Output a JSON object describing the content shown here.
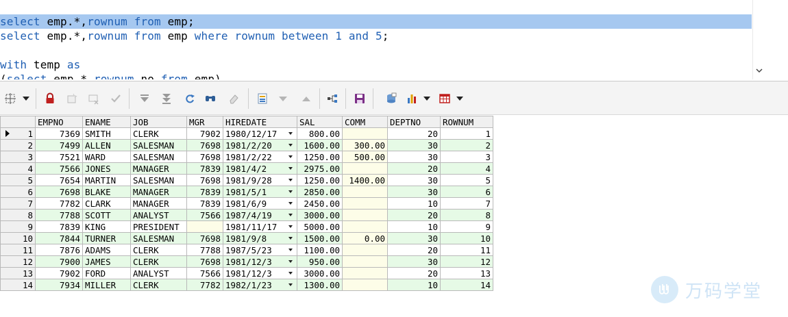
{
  "editor": {
    "lines": [
      {
        "tokens": [
          {
            "t": "select",
            "c": "kw"
          },
          {
            "t": " emp.*,",
            "c": "plain"
          },
          {
            "t": "rownum",
            "c": "kw"
          },
          {
            "t": " ",
            "c": "plain"
          },
          {
            "t": "from",
            "c": "kw"
          },
          {
            "t": " emp;",
            "c": "plain"
          }
        ],
        "highlighted": true
      },
      {
        "tokens": [
          {
            "t": "select",
            "c": "kw"
          },
          {
            "t": " emp.*,",
            "c": "plain"
          },
          {
            "t": "rownum",
            "c": "kw"
          },
          {
            "t": " ",
            "c": "plain"
          },
          {
            "t": "from",
            "c": "kw"
          },
          {
            "t": " emp ",
            "c": "plain"
          },
          {
            "t": "where",
            "c": "kw"
          },
          {
            "t": " ",
            "c": "plain"
          },
          {
            "t": "rownum",
            "c": "kw"
          },
          {
            "t": " ",
            "c": "plain"
          },
          {
            "t": "between",
            "c": "kw"
          },
          {
            "t": " ",
            "c": "plain"
          },
          {
            "t": "1",
            "c": "num"
          },
          {
            "t": " ",
            "c": "plain"
          },
          {
            "t": "and",
            "c": "kw"
          },
          {
            "t": " ",
            "c": "plain"
          },
          {
            "t": "5",
            "c": "num"
          },
          {
            "t": ";",
            "c": "plain"
          }
        ],
        "highlighted": false
      },
      {
        "tokens": [],
        "highlighted": false
      },
      {
        "tokens": [
          {
            "t": "with",
            "c": "kw"
          },
          {
            "t": " temp ",
            "c": "plain"
          },
          {
            "t": "as",
            "c": "kw"
          }
        ],
        "highlighted": false
      },
      {
        "tokens": [
          {
            "t": "(",
            "c": "plain"
          },
          {
            "t": "select",
            "c": "kw"
          },
          {
            "t": " emp.*,",
            "c": "plain"
          },
          {
            "t": "rownum",
            "c": "kw"
          },
          {
            "t": " no ",
            "c": "plain"
          },
          {
            "t": "from",
            "c": "kw"
          },
          {
            "t": " emp)",
            "c": "plain"
          }
        ],
        "highlighted": false
      }
    ]
  },
  "toolbar": {
    "icons": [
      "select-grid-icon",
      "lock-icon",
      "new-record-icon",
      "delete-record-icon",
      "post-check-icon",
      "query-next-page-icon",
      "fetch-all-icon",
      "refresh-icon",
      "find-icon",
      "clear-icon",
      "single-record-view-icon",
      "sort-descending-icon",
      "sort-ascending-icon",
      "export-tree-icon",
      "save-icon",
      "query-by-example-icon",
      "chart-icon",
      "export-table-icon"
    ]
  },
  "grid": {
    "columns": [
      "EMPNO",
      "ENAME",
      "JOB",
      "MGR",
      "HIREDATE",
      "SAL",
      "COMM",
      "DEPTNO",
      "ROWNUM"
    ],
    "rows": [
      [
        "1",
        "7369",
        "SMITH",
        "CLERK",
        "7902",
        "1980/12/17",
        "800.00",
        "",
        "20",
        "1"
      ],
      [
        "2",
        "7499",
        "ALLEN",
        "SALESMAN",
        "7698",
        "1981/2/20",
        "1600.00",
        "300.00",
        "30",
        "2"
      ],
      [
        "3",
        "7521",
        "WARD",
        "SALESMAN",
        "7698",
        "1981/2/22",
        "1250.00",
        "500.00",
        "30",
        "3"
      ],
      [
        "4",
        "7566",
        "JONES",
        "MANAGER",
        "7839",
        "1981/4/2",
        "2975.00",
        "",
        "20",
        "4"
      ],
      [
        "5",
        "7654",
        "MARTIN",
        "SALESMAN",
        "7698",
        "1981/9/28",
        "1250.00",
        "1400.00",
        "30",
        "5"
      ],
      [
        "6",
        "7698",
        "BLAKE",
        "MANAGER",
        "7839",
        "1981/5/1",
        "2850.00",
        "",
        "30",
        "6"
      ],
      [
        "7",
        "7782",
        "CLARK",
        "MANAGER",
        "7839",
        "1981/6/9",
        "2450.00",
        "",
        "10",
        "7"
      ],
      [
        "8",
        "7788",
        "SCOTT",
        "ANALYST",
        "7566",
        "1987/4/19",
        "3000.00",
        "",
        "20",
        "8"
      ],
      [
        "9",
        "7839",
        "KING",
        "PRESIDENT",
        "",
        "1981/11/17",
        "5000.00",
        "",
        "10",
        "9"
      ],
      [
        "10",
        "7844",
        "TURNER",
        "SALESMAN",
        "7698",
        "1981/9/8",
        "1500.00",
        "0.00",
        "30",
        "10"
      ],
      [
        "11",
        "7876",
        "ADAMS",
        "CLERK",
        "7788",
        "1987/5/23",
        "1100.00",
        "",
        "20",
        "11"
      ],
      [
        "12",
        "7900",
        "JAMES",
        "CLERK",
        "7698",
        "1981/12/3",
        "950.00",
        "",
        "30",
        "12"
      ],
      [
        "13",
        "7902",
        "FORD",
        "ANALYST",
        "7566",
        "1981/12/3",
        "3000.00",
        "",
        "20",
        "13"
      ],
      [
        "14",
        "7934",
        "MILLER",
        "CLERK",
        "7782",
        "1982/1/23",
        "1300.00",
        "",
        "10",
        "14"
      ]
    ]
  },
  "watermark": {
    "text": "万码学堂"
  },
  "colors": {
    "keyword": "#1f5fb3",
    "line_highlight": "#a6c8f0",
    "row_alt": "#e6fae6",
    "null_cell": "#fdfde8"
  }
}
